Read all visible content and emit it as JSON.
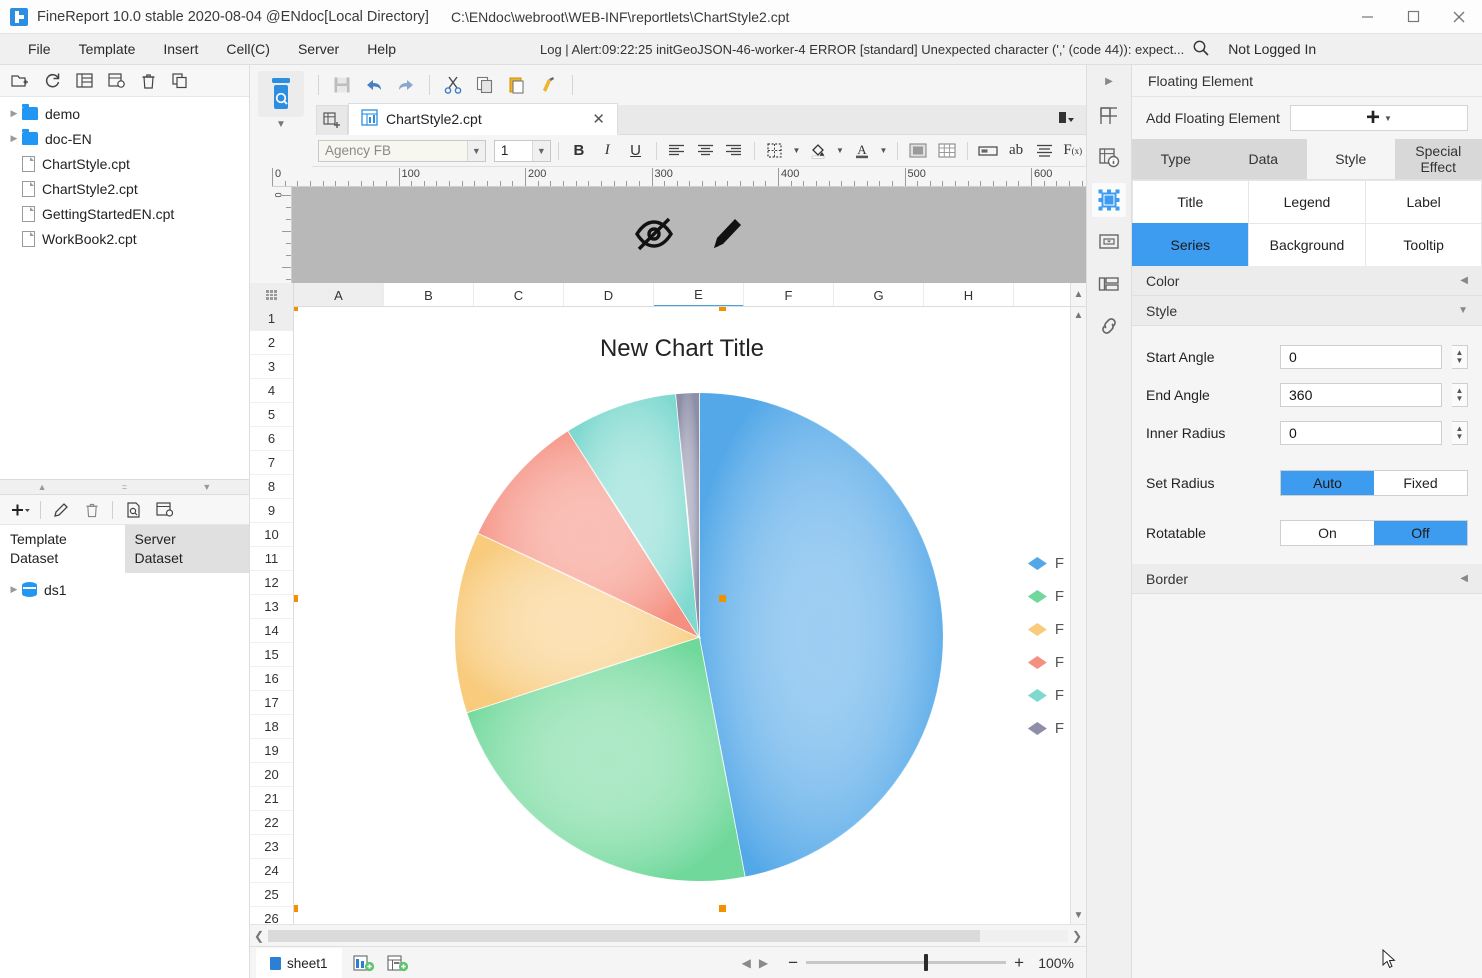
{
  "window": {
    "title": "FineReport 10.0 stable 2020-08-04 @ENdoc[Local Directory]",
    "path": "C:\\ENdoc\\webroot\\WEB-INF\\reportlets\\ChartStyle2.cpt",
    "minimize": "minimize-icon",
    "maximize": "maximize-icon",
    "close": "close-icon"
  },
  "menubar": {
    "items": [
      "File",
      "Template",
      "Insert",
      "Cell(C)",
      "Server",
      "Help"
    ],
    "log_text": "Log | Alert:09:22:25 initGeoJSON-46-worker-4 ERROR [standard] Unexpected character (',' (code 44)): expect...",
    "search_icon": "search-icon",
    "login_status": "Not Logged In"
  },
  "left_panel": {
    "toolbar_icons": [
      "new-folder-icon",
      "refresh-icon",
      "template-icon",
      "settings-icon",
      "delete-icon",
      "copy-icon"
    ],
    "tree": [
      {
        "label": "demo",
        "type": "folder",
        "expandable": true
      },
      {
        "label": "doc-EN",
        "type": "folder",
        "expandable": true
      },
      {
        "label": "ChartStyle.cpt",
        "type": "file",
        "expandable": false
      },
      {
        "label": "ChartStyle2.cpt",
        "type": "file",
        "expandable": false
      },
      {
        "label": "GettingStartedEN.cpt",
        "type": "file",
        "expandable": false
      },
      {
        "label": "WorkBook2.cpt",
        "type": "file",
        "expandable": false
      }
    ],
    "dataset_toolbar_icons": [
      "add-icon",
      "edit-icon",
      "delete-icon",
      "preview-icon",
      "config-icon"
    ],
    "dataset_tabs": [
      {
        "label": "Template\nDataset",
        "line1": "Template",
        "line2": "Dataset",
        "active": true
      },
      {
        "label": "Server\nDataset",
        "line1": "Server",
        "line2": "Dataset",
        "active": false
      }
    ],
    "datasets": [
      {
        "label": "ds1",
        "icon": "database-icon"
      }
    ]
  },
  "center": {
    "big_button_icon": "preview-icon",
    "toolbar_icons": [
      "save-icon",
      "undo-icon",
      "redo-icon",
      "cut-icon",
      "copy-icon",
      "paste-icon",
      "format-painter-icon"
    ],
    "tab": {
      "label": "ChartStyle2.cpt",
      "close": "close-icon",
      "new_sheet_icon": "new-sheet-icon"
    },
    "format_bar": {
      "font_family": "Agency FB",
      "font_size": "1",
      "bold": "B",
      "italic": "I",
      "underline": "U",
      "icons": [
        "align-left-icon",
        "align-center-icon",
        "align-right-icon",
        "border-icon",
        "fill-color-icon",
        "font-color-icon",
        "merge-cell-icon",
        "table-icon",
        "cell-element-icon",
        "text-icon",
        "paragraph-icon",
        "formula-icon"
      ]
    },
    "ruler": {
      "ticks": [
        "0",
        "100",
        "200",
        "300",
        "400",
        "500",
        "600"
      ]
    },
    "design_icons": [
      "hidden-eye-icon",
      "pencil-edit-icon"
    ],
    "columns": [
      "A",
      "B",
      "C",
      "D",
      "E",
      "F",
      "G",
      "H"
    ],
    "rows": [
      "1",
      "2",
      "3",
      "4",
      "5",
      "6",
      "7",
      "8",
      "9",
      "10",
      "11",
      "12",
      "13",
      "14",
      "15",
      "16",
      "17",
      "18",
      "19",
      "20",
      "21",
      "22",
      "23",
      "24",
      "25",
      "26"
    ],
    "chart_title": "New Chart Title",
    "statusbar": {
      "sheet_name": "sheet1",
      "add_sheet_icon": "add-sheet-icon",
      "add_report_icon": "add-report-block-icon",
      "prev_icon": "prev-sheet-icon",
      "next_icon": "next-sheet-icon",
      "zoom_out": "−",
      "zoom_in": "+",
      "zoom_level": "100%"
    }
  },
  "rail": {
    "collapse_icon": "chevron-right-icon",
    "items": [
      "cell-attributes-icon",
      "cell-element-icon",
      "floating-element-icon",
      "widget-settings-icon",
      "report-blocks-icon",
      "hyperlink-icon"
    ],
    "active_index": 2
  },
  "right_panel": {
    "header": "Floating Element",
    "add_label": "Add Floating Element",
    "add_button": "+",
    "tabs": [
      {
        "label": "Type",
        "active": false
      },
      {
        "label": "Data",
        "active": false
      },
      {
        "label": "Style",
        "active": true
      },
      {
        "label": "Special Effect",
        "active": false
      }
    ],
    "style_cells": [
      {
        "label": "Title",
        "active": false
      },
      {
        "label": "Legend",
        "active": false
      },
      {
        "label": "Label",
        "active": false
      },
      {
        "label": "Series",
        "active": true
      },
      {
        "label": "Background",
        "active": false
      },
      {
        "label": "Tooltip",
        "active": false
      }
    ],
    "sections": [
      {
        "label": "Color",
        "state": "collapsed"
      },
      {
        "label": "Style",
        "state": "expanded"
      }
    ],
    "fields": [
      {
        "label": "Start Angle",
        "value": "0"
      },
      {
        "label": "End Angle",
        "value": "360"
      },
      {
        "label": "Inner Radius",
        "value": "0"
      }
    ],
    "toggles": [
      {
        "label": "Set Radius",
        "options": [
          "Auto",
          "Fixed"
        ],
        "selected": "Auto"
      },
      {
        "label": "Rotatable",
        "options": [
          "On",
          "Off"
        ],
        "selected": "Off"
      }
    ],
    "border_section": {
      "label": "Border",
      "state": "collapsed"
    },
    "accent_color": "#3d9bf0"
  },
  "chart_data": {
    "type": "pie",
    "title": "New Chart Title",
    "legend_position": "right",
    "labels": [
      "F",
      "F",
      "F",
      "F",
      "F",
      "F"
    ],
    "values": [
      47,
      23,
      12,
      9,
      7.5,
      1.5
    ],
    "colors": [
      "#54a8e8",
      "#6fd89a",
      "#f8cb7d",
      "#f58f80",
      "#7fd9cf",
      "#8e8ea8"
    ],
    "start_angle": 0,
    "end_angle": 360,
    "inner_radius": 0
  }
}
